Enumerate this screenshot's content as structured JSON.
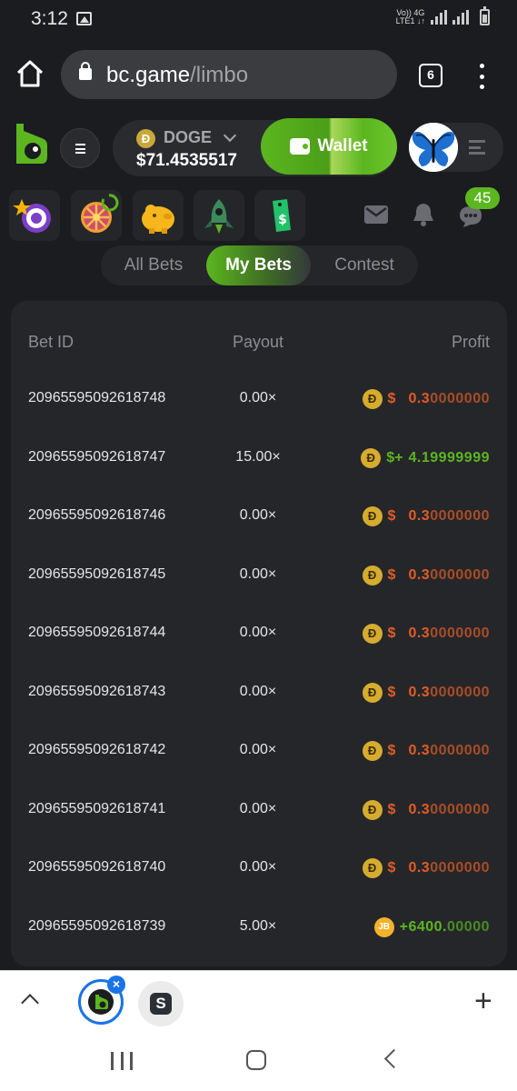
{
  "status_bar": {
    "time": "3:12",
    "network_label_top": "Vo)) 4G",
    "network_label_bottom": "LTE1 ↓↑"
  },
  "browser": {
    "url_host": "bc.game",
    "url_path": "/limbo",
    "tab_count": "6"
  },
  "header": {
    "currency_symbol": "Ð",
    "currency": "DOGE",
    "balance": "$71.4535517",
    "wallet_label": "Wallet"
  },
  "features": {
    "chat_badge": "45"
  },
  "tabs": [
    {
      "label": "All Bets"
    },
    {
      "label": "My Bets"
    },
    {
      "label": "Contest"
    }
  ],
  "table": {
    "columns": {
      "bet_id": "Bet ID",
      "payout": "Payout",
      "profit": "Profit"
    },
    "rows": [
      {
        "id": "20965595092618748",
        "payout": "0.00×",
        "coin": "Ð",
        "prefix": "$",
        "profit_strong": "0.3",
        "profit_light": "0000000"
      },
      {
        "id": "20965595092618747",
        "payout": "15.00×",
        "coin": "Ð",
        "prefix": "$+",
        "profit_strong": "4.19999999",
        "profit_light": ""
      },
      {
        "id": "20965595092618746",
        "payout": "0.00×",
        "coin": "Ð",
        "prefix": "$",
        "profit_strong": "0.3",
        "profit_light": "0000000"
      },
      {
        "id": "20965595092618745",
        "payout": "0.00×",
        "coin": "Ð",
        "prefix": "$",
        "profit_strong": "0.3",
        "profit_light": "0000000"
      },
      {
        "id": "20965595092618744",
        "payout": "0.00×",
        "coin": "Ð",
        "prefix": "$",
        "profit_strong": "0.3",
        "profit_light": "0000000"
      },
      {
        "id": "20965595092618743",
        "payout": "0.00×",
        "coin": "Ð",
        "prefix": "$",
        "profit_strong": "0.3",
        "profit_light": "0000000"
      },
      {
        "id": "20965595092618742",
        "payout": "0.00×",
        "coin": "Ð",
        "prefix": "$",
        "profit_strong": "0.3",
        "profit_light": "0000000"
      },
      {
        "id": "20965595092618741",
        "payout": "0.00×",
        "coin": "Ð",
        "prefix": "$",
        "profit_strong": "0.3",
        "profit_light": "0000000"
      },
      {
        "id": "20965595092618740",
        "payout": "0.00×",
        "coin": "Ð",
        "prefix": "$",
        "profit_strong": "0.3",
        "profit_light": "0000000"
      },
      {
        "id": "20965595092618739",
        "payout": "5.00×",
        "coin": "JB",
        "prefix": "",
        "profit_strong": "+6400.",
        "profit_light": "00000"
      }
    ]
  },
  "tab_strip": {
    "second_tab_letter": "S",
    "close_symbol": "×",
    "plus_symbol": "+"
  },
  "colors": {
    "accent_green": "#5bb61f",
    "loss_orange": "#e15d24",
    "panel": "#25262a",
    "background": "#1b1c1f"
  }
}
